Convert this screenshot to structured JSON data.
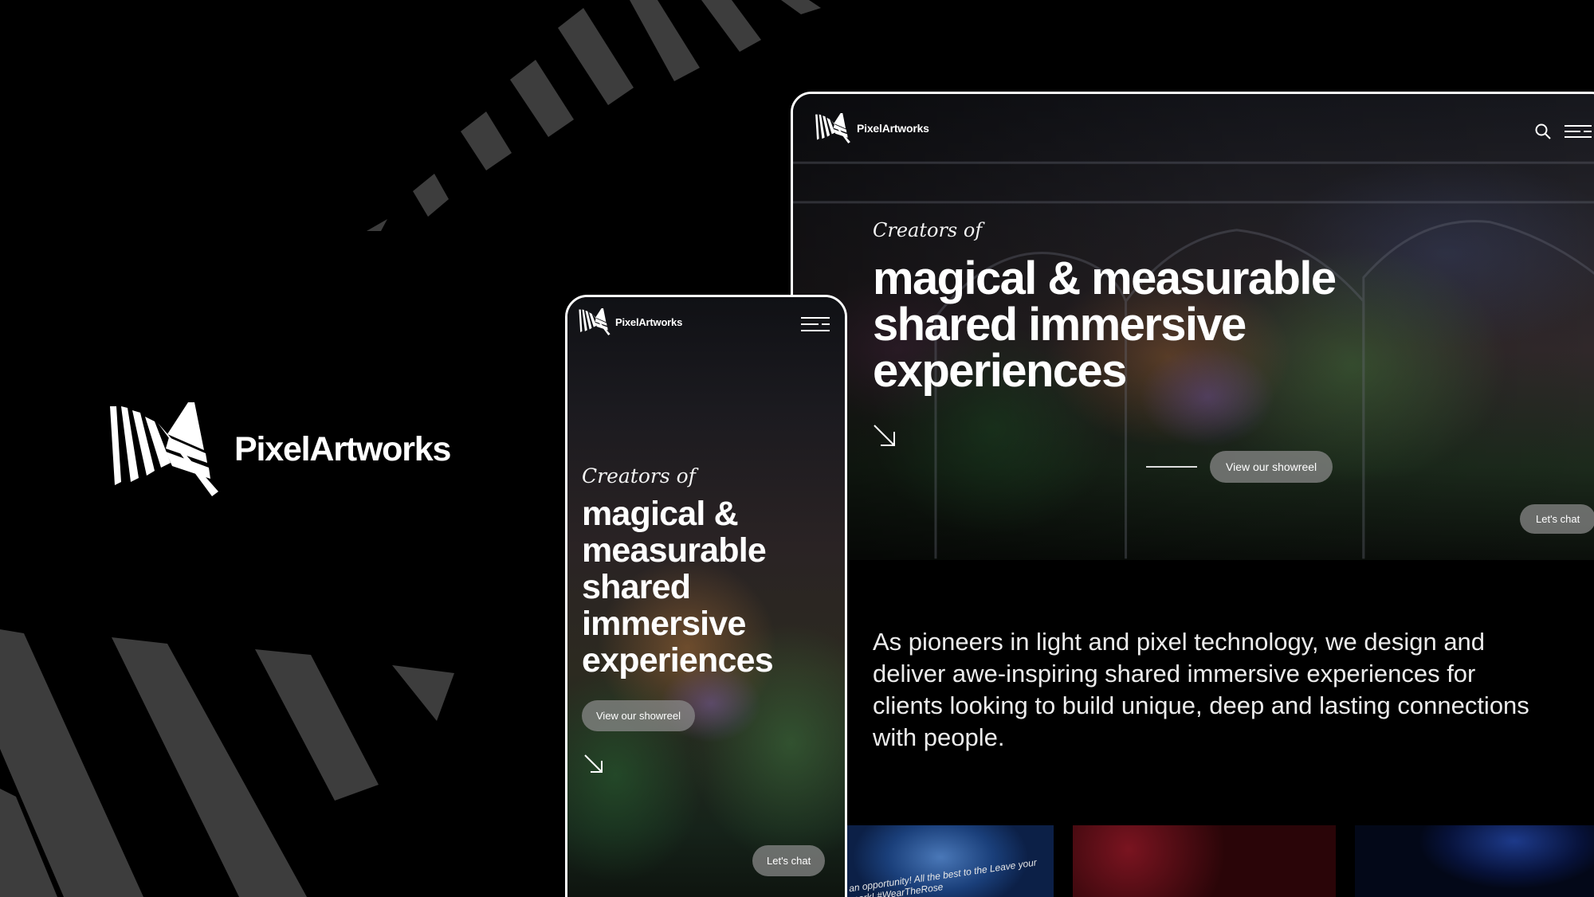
{
  "brand": {
    "name": "PixelArtworks"
  },
  "desktop": {
    "nav": {
      "logo_text": "PixelArtworks",
      "search_icon": "search-icon",
      "menu_icon": "menu-icon"
    },
    "hero": {
      "eyebrow": "Creators of",
      "headline_lines": [
        "magical & measurable",
        "shared immersive",
        "experiences"
      ],
      "showreel_button": "View our showreel",
      "arrow_icon": "arrow-down-right-icon",
      "chat_button": "Let's chat"
    },
    "intro_text": "As pioneers in light and pixel technology, we design and deliver awe-inspiring shared immersive experiences for clients looking to build unique, deep and lasting connections with people.",
    "thumbnail_text": "an opportunity! All the best to the Leave your mark! #WearTheRose"
  },
  "mobile": {
    "nav": {
      "logo_text": "PixelArtworks",
      "menu_icon": "menu-icon"
    },
    "hero": {
      "eyebrow": "Creators of",
      "headline_lines": [
        "magical &",
        "measurable",
        "shared",
        "immersive",
        "experiences"
      ],
      "showreel_button": "View our showreel",
      "arrow_icon": "arrow-down-right-icon",
      "chat_button": "Let's chat"
    }
  },
  "colors": {
    "background": "#000000",
    "text": "#ffffff",
    "stripe": "#3d3d3d",
    "pill": "#8c8c8c"
  }
}
